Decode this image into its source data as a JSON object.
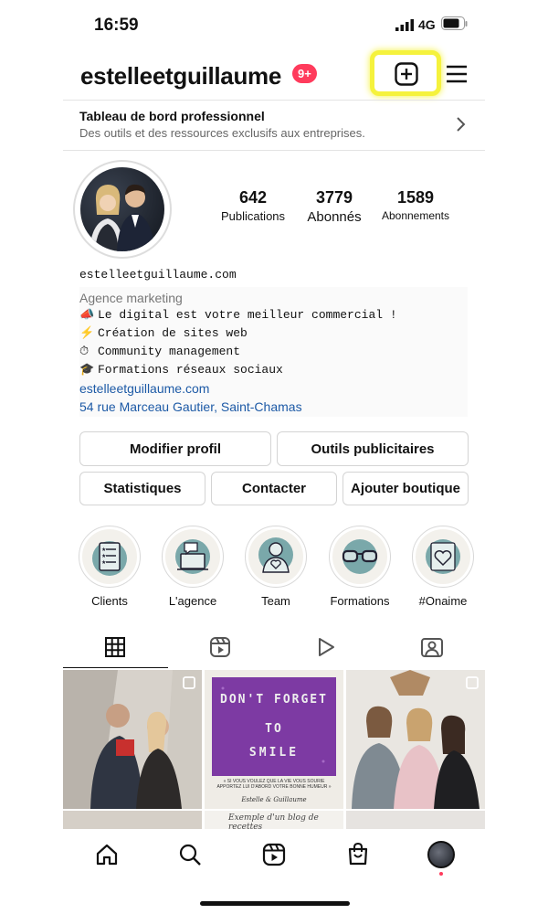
{
  "status": {
    "time": "16:59",
    "network": "4G"
  },
  "header": {
    "username": "estelleetguillaume",
    "notifications": "9+"
  },
  "dashboard": {
    "title": "Tableau de bord professionnel",
    "subtitle": "Des outils et des ressources exclusifs aux entreprises."
  },
  "stats": [
    {
      "value": "642",
      "label": "Publications"
    },
    {
      "value": "3779",
      "label": "Abonnés"
    },
    {
      "value": "1589",
      "label": "Abonnements"
    }
  ],
  "bio": {
    "website_top": "estelleetguillaume.com",
    "category": "Agence marketing",
    "lines": [
      {
        "emoji": "📣",
        "text": "Le digital est votre meilleur commercial !"
      },
      {
        "emoji": "⚡",
        "text": "Création de sites web"
      },
      {
        "emoji": "⏱",
        "text": "Community management"
      },
      {
        "emoji": "🎓",
        "text": "Formations réseaux sociaux"
      }
    ],
    "link": "estelleetguillaume.com",
    "address": "54 rue Marceau Gautier, Saint-Chamas"
  },
  "buttons": {
    "edit_profile": "Modifier profil",
    "ad_tools": "Outils publicitaires",
    "insights": "Statistiques",
    "contact": "Contacter",
    "add_shop": "Ajouter boutique"
  },
  "highlights": [
    {
      "label": "Clients"
    },
    {
      "label": "L'agence"
    },
    {
      "label": "Team"
    },
    {
      "label": "Formations"
    },
    {
      "label": "#Onaime"
    }
  ],
  "posts": {
    "post2_line1": "DON'T FORGET",
    "post2_line2": "TO",
    "post2_line3": "SMILE",
    "post2_caption": "« SI VOUS VOULEZ QUE LA VIE VOUS SOURIE APPORTEZ LUI D'ABORD VOTRE BONNE HUMEUR »",
    "post2_sign": "Estelle & Guillaume",
    "post5_text": "Exemple d'un blog de recettes"
  },
  "colors": {
    "accent_blue": "#1d5aa6",
    "highlight_yellow": "#f5f23d",
    "badge_red": "#ff3b5c",
    "highlight_teal": "#7aa8aa"
  }
}
